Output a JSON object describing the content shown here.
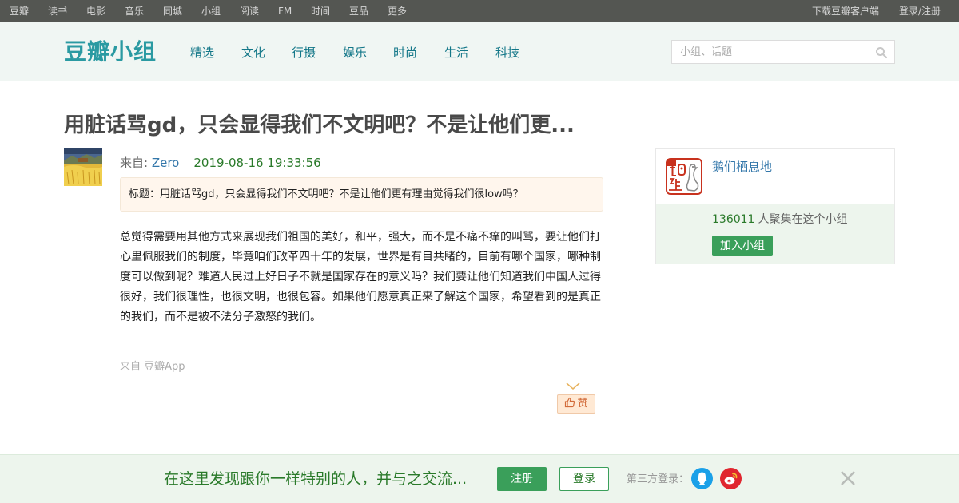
{
  "topnav": {
    "left": [
      "豆瓣",
      "读书",
      "电影",
      "音乐",
      "同城",
      "小组",
      "阅读",
      "FM",
      "时间",
      "豆品",
      "更多"
    ],
    "download": "下载豆瓣客户端",
    "login": "登录/注册"
  },
  "header": {
    "logo": "豆瓣小组",
    "nav": [
      "精选",
      "文化",
      "行摄",
      "娱乐",
      "时尚",
      "生活",
      "科技"
    ],
    "search_placeholder": "小组、话题"
  },
  "post": {
    "title": "用脏话骂gd，只会显得我们不文明吧？不是让他们更...",
    "from_label": "来自: ",
    "author": "Zero",
    "time": "2019-08-16 19:33:56",
    "subject": "标题：用脏话骂gd，只会显得我们不文明吧？不是让他们更有理由觉得我们很low吗？",
    "body": "总觉得需要用其他方式来展现我们祖国的美好，和平，强大，而不是不痛不痒的叫骂，要让他们打心里佩服我们的制度，毕竟咱们改革四十年的发展，世界是有目共睹的，目前有哪个国家，哪种制度可以做到呢？难道人民过上好日子不就是国家存在的意义吗？我们要让他们知道我们中国人过得很好，我们很理性，也很文明，也很包容。如果他们愿意真正来了解这个国家，希望看到的是真正的我们，而不是被不法分子激怒的我们。",
    "source": "来自 豆瓣App",
    "like_label": "赞"
  },
  "group": {
    "name": "鹅们栖息地",
    "member_count": "136011",
    "member_text": "人聚集在这个小组",
    "join_label": "加入小组"
  },
  "bottombar": {
    "text": "在这里发现跟你一样特别的人，并与之交流...",
    "register": "注册",
    "login": "登录",
    "third_party": "第三方登录："
  },
  "colors": {
    "topbar": "#545652",
    "brand": "#2a9aa2",
    "link": "#3377aa",
    "green": "#3a9f5a"
  }
}
